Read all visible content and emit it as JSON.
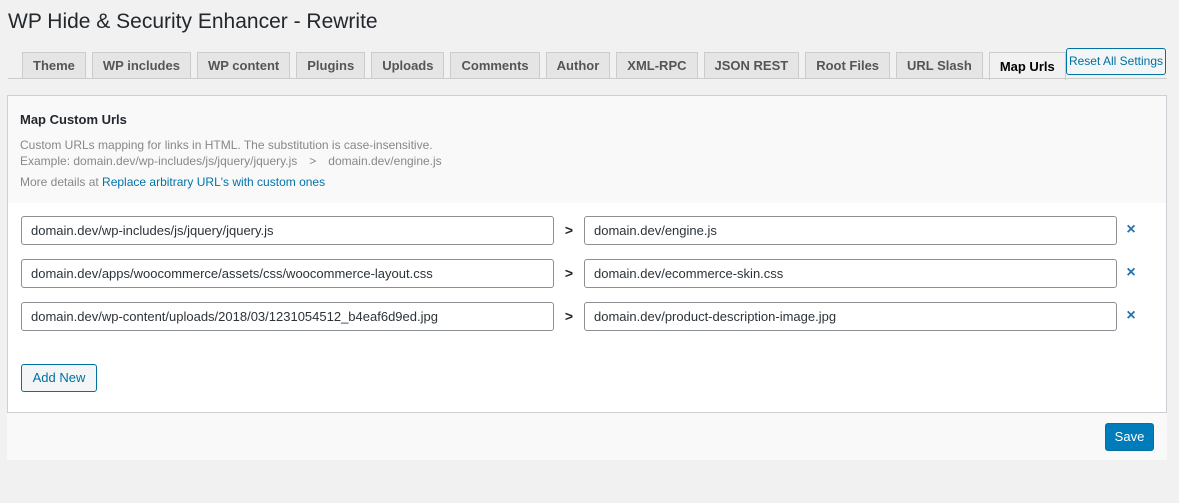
{
  "page_title": "WP Hide & Security Enhancer - Rewrite",
  "tabs": [
    {
      "label": "Theme"
    },
    {
      "label": "WP includes"
    },
    {
      "label": "WP content"
    },
    {
      "label": "Plugins"
    },
    {
      "label": "Uploads"
    },
    {
      "label": "Comments"
    },
    {
      "label": "Author"
    },
    {
      "label": "XML-RPC"
    },
    {
      "label": "JSON REST"
    },
    {
      "label": "Root Files"
    },
    {
      "label": "URL Slash"
    },
    {
      "label": "Map Urls",
      "active": true
    }
  ],
  "reset_label": "Reset All Settings",
  "section": {
    "title": "Map Custom Urls",
    "description": "Custom URLs mapping for links in HTML. The substitution is case-insensitive.",
    "example_prefix": "Example: domain.dev/wp-includes/js/jquery/jquery.js",
    "example_arrow": ">",
    "example_target": "domain.dev/engine.js",
    "more_prefix": "More details at",
    "more_link": "Replace arbitrary URL's with custom ones"
  },
  "mappings": [
    {
      "source": "domain.dev/wp-includes/js/jquery/jquery.js",
      "target": "domain.dev/engine.js"
    },
    {
      "source": "domain.dev/apps/woocommerce/assets/css/woocommerce-layout.css",
      "target": "domain.dev/ecommerce-skin.css"
    },
    {
      "source": "domain.dev/wp-content/uploads/2018/03/1231054512_b4eaf6d9ed.jpg",
      "target": "domain.dev/product-description-image.jpg"
    }
  ],
  "row_arrow": ">",
  "remove_glyph": "×",
  "add_new_label": "Add New",
  "save_label": "Save",
  "icons": {
    "arrow": "chevron-right-icon",
    "remove": "close-icon"
  },
  "colors": {
    "accent": "#0071a1",
    "primary_button": "#007cba",
    "link": "#0073aa"
  }
}
